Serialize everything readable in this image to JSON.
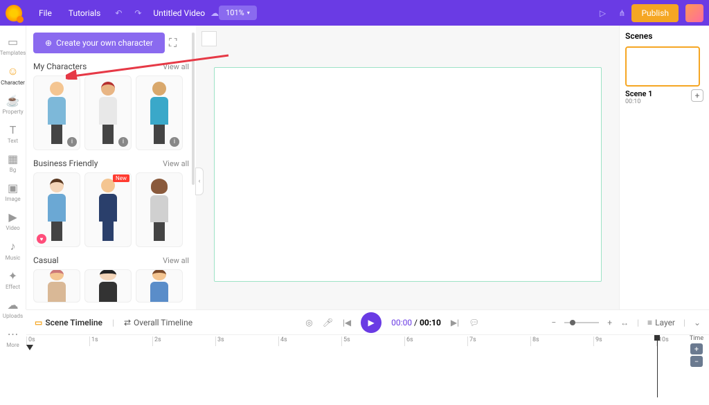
{
  "topbar": {
    "file": "File",
    "tutorials": "Tutorials",
    "title": "Untitled Video",
    "zoom": "101%",
    "publish": "Publish"
  },
  "sidenav": [
    {
      "id": "templates",
      "label": "Templates"
    },
    {
      "id": "character",
      "label": "Character"
    },
    {
      "id": "property",
      "label": "Property"
    },
    {
      "id": "text",
      "label": "Text"
    },
    {
      "id": "bg",
      "label": "Bg"
    },
    {
      "id": "image",
      "label": "Image"
    },
    {
      "id": "video",
      "label": "Video"
    },
    {
      "id": "music",
      "label": "Music"
    },
    {
      "id": "effect",
      "label": "Effect"
    },
    {
      "id": "uploads",
      "label": "Uploads"
    },
    {
      "id": "more",
      "label": "More"
    }
  ],
  "panel": {
    "create_btn": "Create your own character",
    "sections": {
      "my": "My Characters",
      "business": "Business Friendly",
      "casual": "Casual"
    },
    "view_all": "View all",
    "new_tag": "New"
  },
  "scenes": {
    "title": "Scenes",
    "scene1": {
      "label": "Scene 1",
      "time": "00:10"
    }
  },
  "timeline": {
    "scene_tab": "Scene Timeline",
    "overall_tab": "Overall Timeline",
    "current": "00:00",
    "total": "00:10",
    "sep": " / ",
    "layer": "Layer",
    "marks": [
      "0s",
      "1s",
      "2s",
      "3s",
      "4s",
      "5s",
      "6s",
      "7s",
      "8s",
      "9s",
      "10s"
    ],
    "time_label": "Time"
  }
}
